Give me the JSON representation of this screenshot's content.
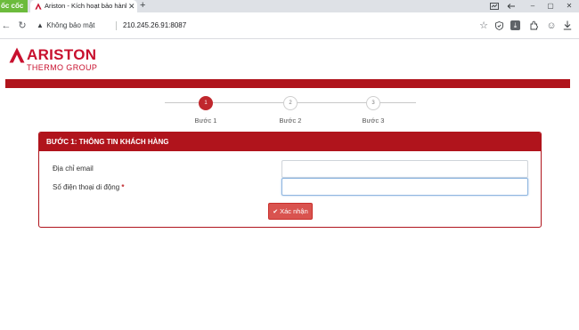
{
  "browser": {
    "brand": "ốc cốc",
    "tab_title": "Ariston - Kích hoạt bảo hành",
    "tab_close": "✕",
    "new_tab": "+",
    "security_text": "Không bảo mật",
    "url": "210.245.26.91:8087",
    "icons": {
      "back": "←",
      "reload": "↻",
      "minimize": "–",
      "restore": "▢",
      "close": "✕",
      "bookmark": "☆",
      "download": "⤓",
      "profile": "☺",
      "more": "⋮"
    }
  },
  "header": {
    "logo_name": "ARISTON",
    "logo_sub": "THERMO GROUP",
    "brand_color": "#b0141c"
  },
  "stepper": {
    "steps": [
      {
        "number": "1",
        "label": "Bước 1",
        "active": true
      },
      {
        "number": "2",
        "label": "Bước 2",
        "active": false
      },
      {
        "number": "3",
        "label": "Bước 3",
        "active": false
      }
    ]
  },
  "form": {
    "title": "BƯỚC 1: THÔNG TIN KHÁCH HÀNG",
    "email_label": "Địa chỉ email",
    "phone_label": "Số điện thoại di động",
    "required_mark": "*",
    "email_value": "",
    "phone_value": "",
    "submit_label": "Xác nhận",
    "submit_icon": "✔"
  }
}
